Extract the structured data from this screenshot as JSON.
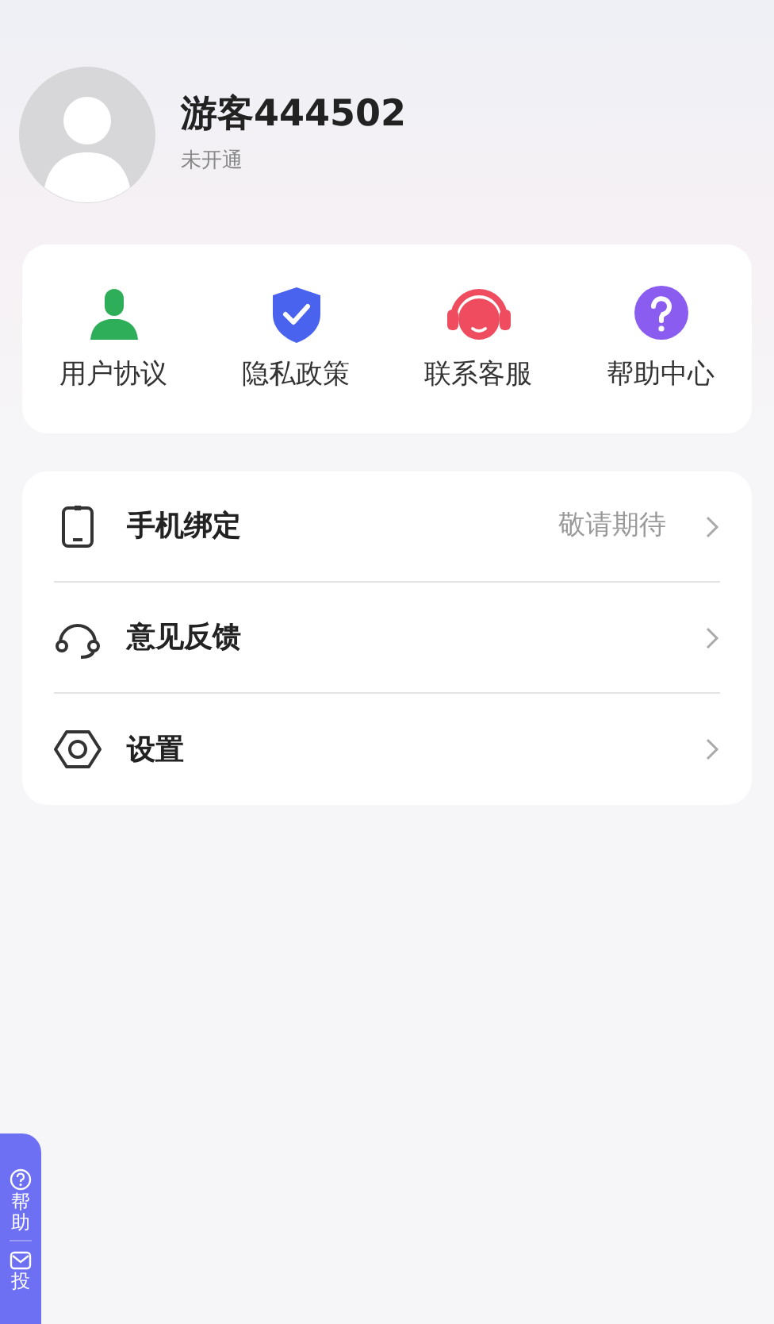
{
  "profile": {
    "name": "游客444502",
    "status": "未开通"
  },
  "shortcuts": [
    {
      "kind": "user",
      "label": "用户协议"
    },
    {
      "kind": "shield",
      "label": "隐私政策"
    },
    {
      "kind": "headset",
      "label": "联系客服"
    },
    {
      "kind": "help",
      "label": "帮助中心"
    }
  ],
  "menu": [
    {
      "kind": "phone",
      "label": "手机绑定",
      "value": "敬请期待"
    },
    {
      "kind": "feedback",
      "label": "意见反馈"
    },
    {
      "kind": "settings",
      "label": "设置"
    }
  ],
  "side_tab": [
    {
      "kind": "help",
      "label": "帮助"
    },
    {
      "kind": "mail",
      "label": "投"
    }
  ]
}
